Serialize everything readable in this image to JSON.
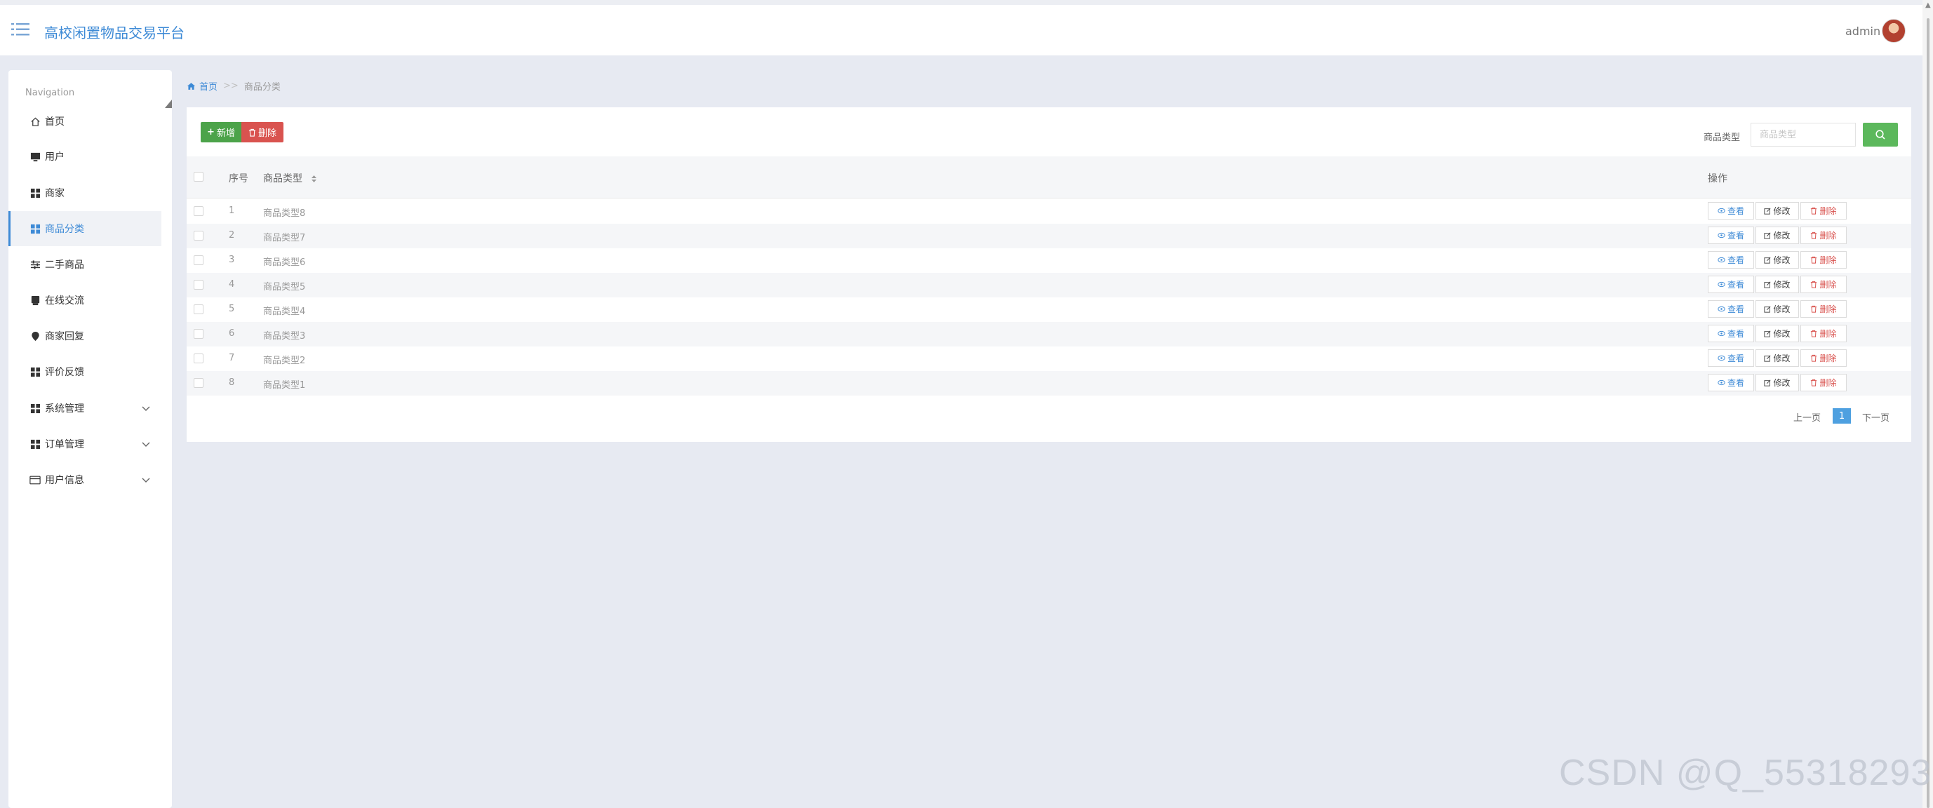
{
  "app": {
    "title": "高校闲置物品交易平台",
    "user": "admin"
  },
  "sidebar": {
    "caption": "Navigation",
    "items": [
      {
        "label": "首页",
        "icon": "home-icon"
      },
      {
        "label": "用户",
        "icon": "monitor-icon"
      },
      {
        "label": "商家",
        "icon": "grid-icon"
      },
      {
        "label": "商品分类",
        "icon": "grid-icon"
      },
      {
        "label": "二手商品",
        "icon": "sliders-icon"
      },
      {
        "label": "在线交流",
        "icon": "chat-icon"
      },
      {
        "label": "商家回复",
        "icon": "pin-icon"
      },
      {
        "label": "评价反馈",
        "icon": "grid-icon"
      },
      {
        "label": "系统管理",
        "icon": "grid-icon"
      },
      {
        "label": "订单管理",
        "icon": "grid-icon"
      },
      {
        "label": "用户信息",
        "icon": "card-icon"
      }
    ]
  },
  "breadcrumb": {
    "home": "首页",
    "separator": ">>",
    "current": "商品分类"
  },
  "toolbar": {
    "add_label": "新增",
    "delete_label": "删除"
  },
  "filter": {
    "label": "商品类型",
    "placeholder": "商品类型"
  },
  "table": {
    "headers": {
      "index": "序号",
      "type": "商品类型",
      "actions": "操作"
    },
    "rows": [
      {
        "index": "1",
        "type": "商品类型8"
      },
      {
        "index": "2",
        "type": "商品类型7"
      },
      {
        "index": "3",
        "type": "商品类型6"
      },
      {
        "index": "4",
        "type": "商品类型5"
      },
      {
        "index": "5",
        "type": "商品类型4"
      },
      {
        "index": "6",
        "type": "商品类型3"
      },
      {
        "index": "7",
        "type": "商品类型2"
      },
      {
        "index": "8",
        "type": "商品类型1"
      }
    ],
    "actions": {
      "view": "查看",
      "edit": "修改",
      "delete": "删除"
    }
  },
  "pagination": {
    "prev": "上一页",
    "current": "1",
    "next": "下一页"
  },
  "watermark": "CSDN @Q_55318293",
  "colors": {
    "primary": "#3d8ad6",
    "success": "#4ca34a",
    "danger": "#d9534f",
    "background": "#e7eaf2"
  }
}
